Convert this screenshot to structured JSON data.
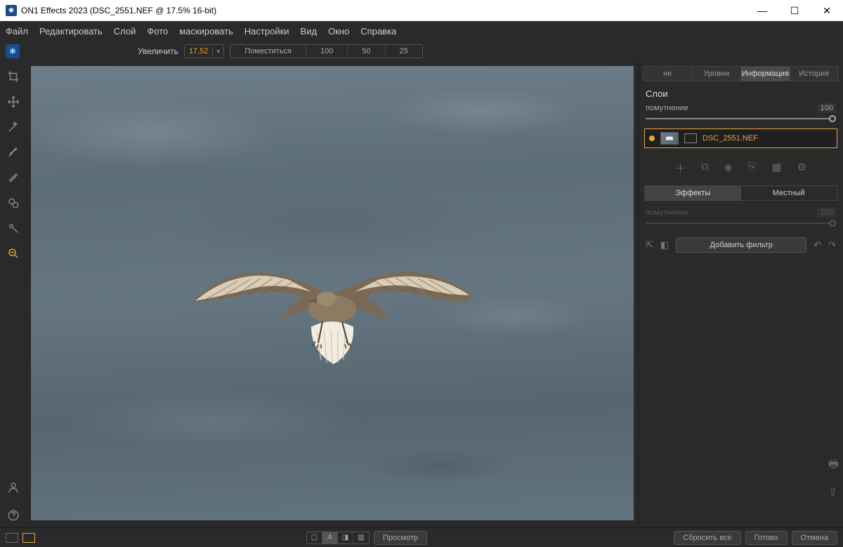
{
  "title": "ON1 Effects 2023 (DSC_2551.NEF @ 17.5% 16-bit)",
  "menu": {
    "file": "Файл",
    "edit": "Редактировать",
    "layer": "Слой",
    "photo": "Фото",
    "mask": "маскировать",
    "settings": "Настройки",
    "view": "Вид",
    "window": "Окно",
    "help": "Справка"
  },
  "zoom": {
    "label": "Увеличить",
    "value": "17,52",
    "fit": "Поместиться",
    "p100": "100",
    "p50": "50",
    "p25": "25"
  },
  "tabs": {
    "ne": "не",
    "levels": "Уровни",
    "info": "Информация",
    "history": "История"
  },
  "layers": {
    "title": "Слои",
    "opacity_label": "помутнение",
    "opacity_value": "100",
    "item_name": "DSC_2551.NEF"
  },
  "mode": {
    "effects": "Эффекты",
    "local": "Местный"
  },
  "effects": {
    "opacity_label": "помутнение",
    "opacity_value": "100",
    "add_filter": "Добавить фильтр"
  },
  "bottom": {
    "preview": "Просмотр",
    "reset": "Сбросить все",
    "done": "Готово",
    "cancel": "Отмена"
  }
}
